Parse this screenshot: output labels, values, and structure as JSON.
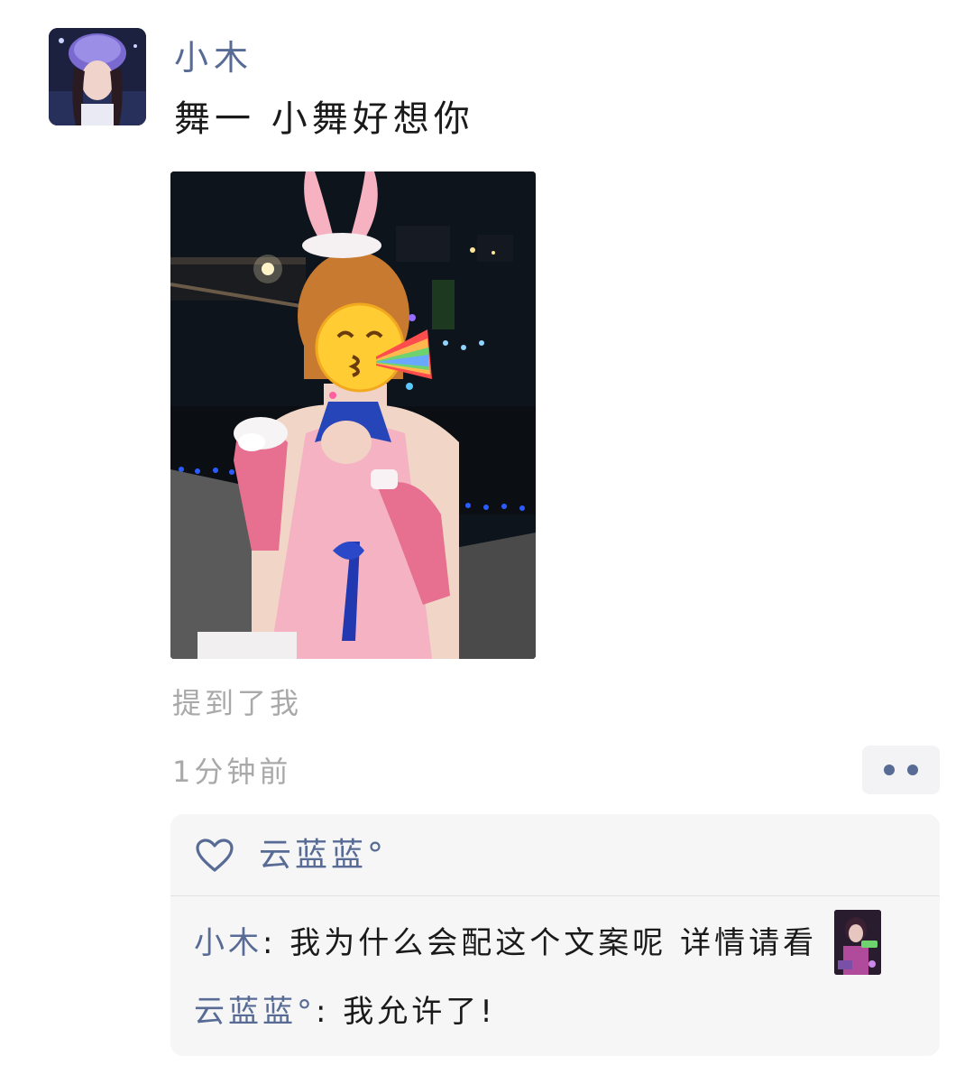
{
  "post": {
    "username": "小木",
    "text": "舞一 小舞好想你",
    "mention_text": "提到了我",
    "timestamp": "1分钟前",
    "avatar_icon": "user-avatar",
    "photo_icon": "cosplay-photo"
  },
  "likes": {
    "icon": "heart-outline-icon",
    "names": [
      "云蓝蓝°"
    ]
  },
  "comments": [
    {
      "author": "小木",
      "separator": ":",
      "text": " 我为什么会配这个文案呢 详情请看",
      "has_image": true
    },
    {
      "author": "云蓝蓝°",
      "separator": ":",
      "text": " 我允许了!",
      "has_image": false
    }
  ],
  "colors": {
    "link": "#576b95",
    "meta": "#a9a9a9",
    "panel": "#f6f6f7",
    "text": "#1a1a1a"
  }
}
